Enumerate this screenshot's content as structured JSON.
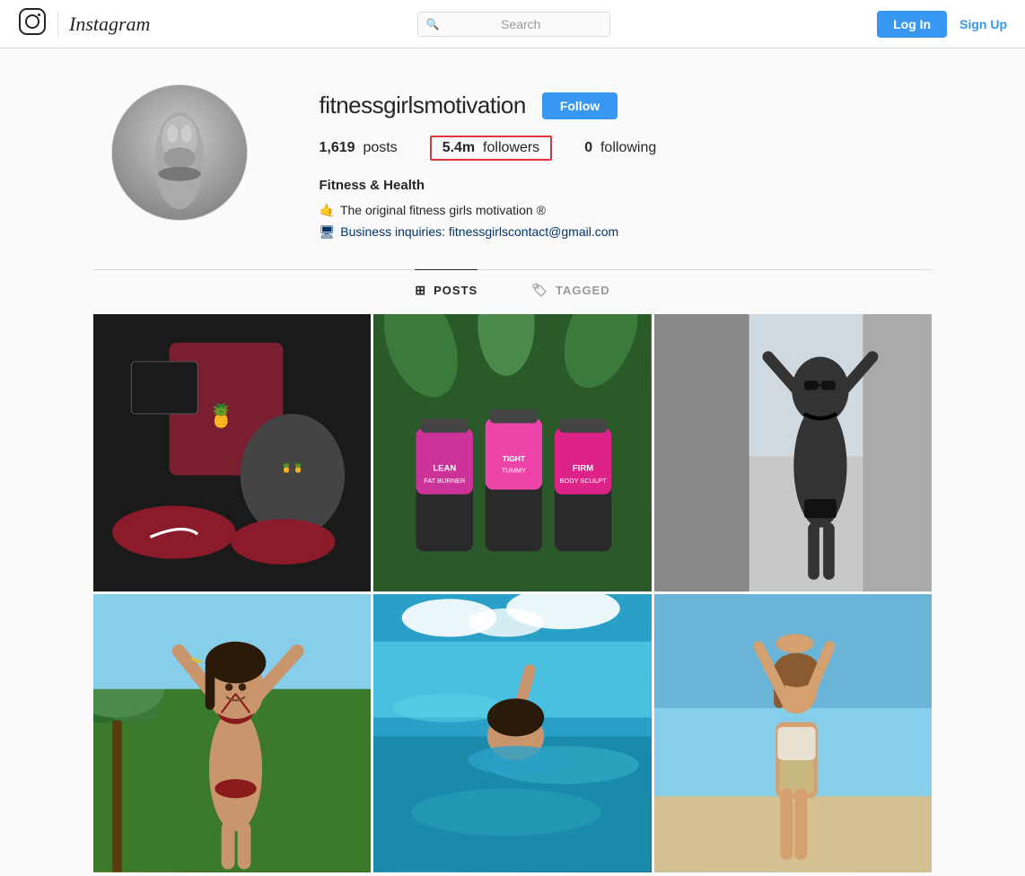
{
  "header": {
    "logo_text": "Instagram",
    "search_placeholder": "Search",
    "login_label": "Log In",
    "signup_label": "Sign Up"
  },
  "profile": {
    "username": "fitnessgirlsmotivation",
    "follow_label": "Follow",
    "stats": {
      "posts_count": "1,619",
      "posts_label": "posts",
      "followers_count": "5.4m",
      "followers_label": "followers",
      "following_count": "0",
      "following_label": "following"
    },
    "bio": {
      "name": "Fitness & Health",
      "line1": "The original fitness girls motivation ®",
      "line2": "Business inquiries: fitnessgirlscontact@gmail.com"
    }
  },
  "tabs": [
    {
      "label": "POSTS",
      "icon": "grid",
      "active": true
    },
    {
      "label": "TAGGED",
      "icon": "tag",
      "active": false
    }
  ],
  "photos": [
    {
      "id": 1,
      "alt": "Fitness outfit flatlay"
    },
    {
      "id": 2,
      "alt": "Supplement bottles"
    },
    {
      "id": 3,
      "alt": "Woman in black bikini"
    },
    {
      "id": 4,
      "alt": "Woman smiling outdoors"
    },
    {
      "id": 5,
      "alt": "Woman swimming in ocean"
    },
    {
      "id": 6,
      "alt": "Woman hands up sky"
    }
  ],
  "icons": {
    "instagram_logo": "⬜",
    "search": "🔍",
    "grid": "⊞",
    "tag": "🏷",
    "flower": "🌸",
    "laptop": "💻"
  }
}
